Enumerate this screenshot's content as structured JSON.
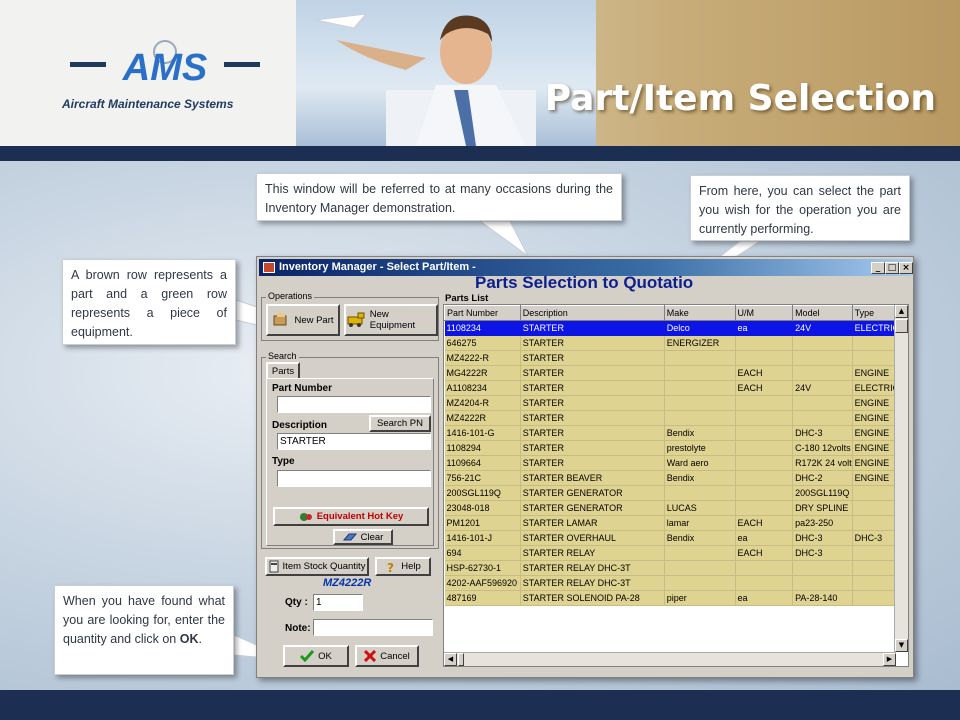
{
  "slide": {
    "title": "Part/Item Selection",
    "logo_text": "AMS",
    "logo_subtitle": "Aircraft Maintenance Systems"
  },
  "callouts": {
    "window": "This window will be referred to at many occasions during the Inventory Manager demonstration.",
    "select": "From here, you can select the part you wish for the operation you are currently performing.",
    "rows": "A brown row represents a part and a green row represents  a piece of equipment.",
    "qty_prefix": "When you have found what you are looking for, enter the quantity and click on ",
    "qty_bold": "OK",
    "qty_suffix": "."
  },
  "window": {
    "title": "Inventory Manager - Select Part/Item -",
    "grid_title": "Parts Selection to Quotatio",
    "list_label": "Parts List",
    "operations_label": "Operations",
    "new_part": "New Part",
    "new_equipment": "New Equipment",
    "search_label": "Search",
    "tab_parts": "Parts",
    "part_number_label": "Part Number",
    "part_number_value": "",
    "description_label": "Description",
    "description_value": "STARTER",
    "search_pn": "Search PN",
    "type_label": "Type",
    "type_value": "",
    "equiv_hotkey": "Equivalent Hot Key",
    "clear": "Clear",
    "stock_qty": "Item Stock Quantity",
    "help": "Help",
    "selected_item": "MZ4222R",
    "qty_label": "Qty :",
    "qty_value": "1",
    "note_label": "Note:",
    "note_value": "",
    "ok": "OK",
    "cancel": "Cancel"
  },
  "table": {
    "columns": [
      "Part Number",
      "Description",
      "Make",
      "U/M",
      "Model",
      "Type"
    ],
    "rows": [
      [
        "1108234",
        "STARTER",
        "Delco",
        "ea",
        "24V",
        "ELECTRIC"
      ],
      [
        "646275",
        "STARTER",
        "ENERGIZER",
        "",
        "",
        ""
      ],
      [
        "MZ4222-R",
        "STARTER",
        "",
        "",
        "",
        ""
      ],
      [
        "MG4222R",
        "STARTER",
        "",
        "EACH",
        "",
        "ENGINE"
      ],
      [
        "A1108234",
        "STARTER",
        "",
        "EACH",
        "24V",
        "ELECTRIC"
      ],
      [
        "MZ4204-R",
        "STARTER",
        "",
        "",
        "",
        "ENGINE"
      ],
      [
        "MZ4222R",
        "STARTER",
        "",
        "",
        "",
        "ENGINE"
      ],
      [
        "1416-101-G",
        "STARTER",
        "Bendix",
        "",
        "DHC-3",
        "ENGINE"
      ],
      [
        "1108294",
        "STARTER",
        "prestolyte",
        "",
        "C-180 12volts",
        "ENGINE"
      ],
      [
        "1109664",
        "STARTER",
        "Ward aero",
        "",
        "R172K 24 volt",
        "ENGINE"
      ],
      [
        "756-21C",
        "STARTER BEAVER",
        "Bendix",
        "",
        "DHC-2",
        "ENGINE"
      ],
      [
        "200SGL119Q",
        "STARTER GENERATOR",
        "",
        "",
        "200SGL119Q",
        ""
      ],
      [
        "23048-018",
        "STARTER GENERATOR",
        "LUCAS",
        "",
        "DRY SPLINE",
        ""
      ],
      [
        "PM1201",
        "STARTER LAMAR",
        "lamar",
        "EACH",
        "pa23-250",
        ""
      ],
      [
        "1416-101-J",
        "STARTER OVERHAUL",
        "Bendix",
        "ea",
        "DHC-3",
        "DHC-3"
      ],
      [
        "694",
        "STARTER RELAY",
        "",
        "EACH",
        "DHC-3",
        ""
      ],
      [
        "HSP-62730-1",
        "STARTER RELAY DHC-3T",
        "",
        "",
        "",
        ""
      ],
      [
        "4202-AAF596920",
        "STARTER RELAY DHC-3T",
        "",
        "",
        "",
        ""
      ],
      [
        "487169",
        "STARTER SOLENOID PA-28",
        "piper",
        "ea",
        "PA-28-140",
        ""
      ]
    ],
    "selected_index": 0
  },
  "colors": {
    "part_row": "#dfd392",
    "selected_row": "#0d14e6",
    "header_band": "#1c2f52",
    "grid_title": "#0c1f8e"
  }
}
